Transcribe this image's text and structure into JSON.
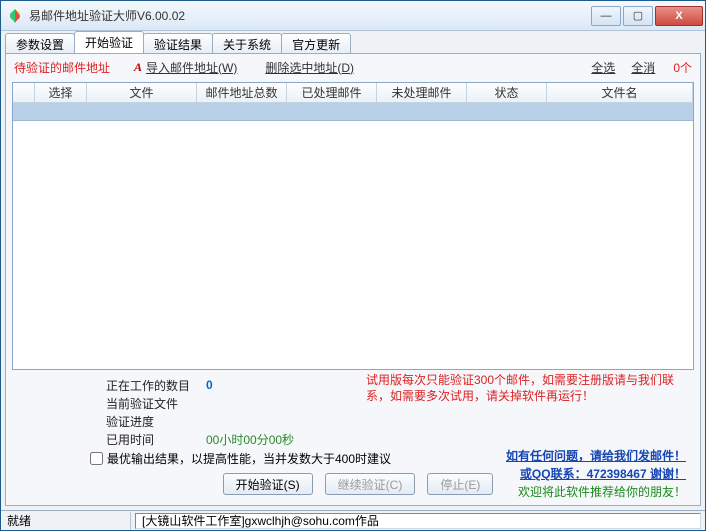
{
  "window": {
    "title": "易邮件地址验证大师V6.00.02"
  },
  "winbtns": {
    "min": "—",
    "max": "▢",
    "close": "X"
  },
  "tabs": [
    {
      "label": "参数设置"
    },
    {
      "label": "开始验证"
    },
    {
      "label": "验证结果"
    },
    {
      "label": "关于系统"
    },
    {
      "label": "官方更新"
    }
  ],
  "toolbar": {
    "pending": "待验证的邮件地址",
    "a": "A",
    "import": "导入邮件地址(W)",
    "delete": "删除选中地址(D)",
    "selall": "全选",
    "selnone": "全消",
    "count": "0个"
  },
  "columns": {
    "c1": "选择",
    "c2": "文件",
    "c3": "邮件地址总数",
    "c4": "已处理邮件",
    "c5": "未处理邮件",
    "c6": "状态",
    "c7": "文件名"
  },
  "footer": {
    "working_label": "正在工作的数目",
    "working_val": "0",
    "curfile_label": "当前验证文件",
    "progress_label": "验证进度",
    "time_label": "已用时间",
    "time_val": "00小时00分00秒",
    "optcheck": "最优输出结果，以提高性能，当并发数大于400时建议"
  },
  "trial": "试用版每次只能验证300个邮件，如需要注册版请与我们联系，如需要多次试用，请关掉软件再运行！",
  "contact": {
    "l1": "如有任何问题，请给我们发邮件！",
    "l2": "或QQ联系：472398467   谢谢！",
    "l3": "欢迎将此软件推荐给你的朋友！"
  },
  "buttons": {
    "start": "开始验证(S)",
    "cont": "继续验证(C)",
    "stop": "停止(E)"
  },
  "status": {
    "ready": "就绪",
    "author": "[大镜山软件工作室]gxwclhjh@sohu.com作品"
  }
}
